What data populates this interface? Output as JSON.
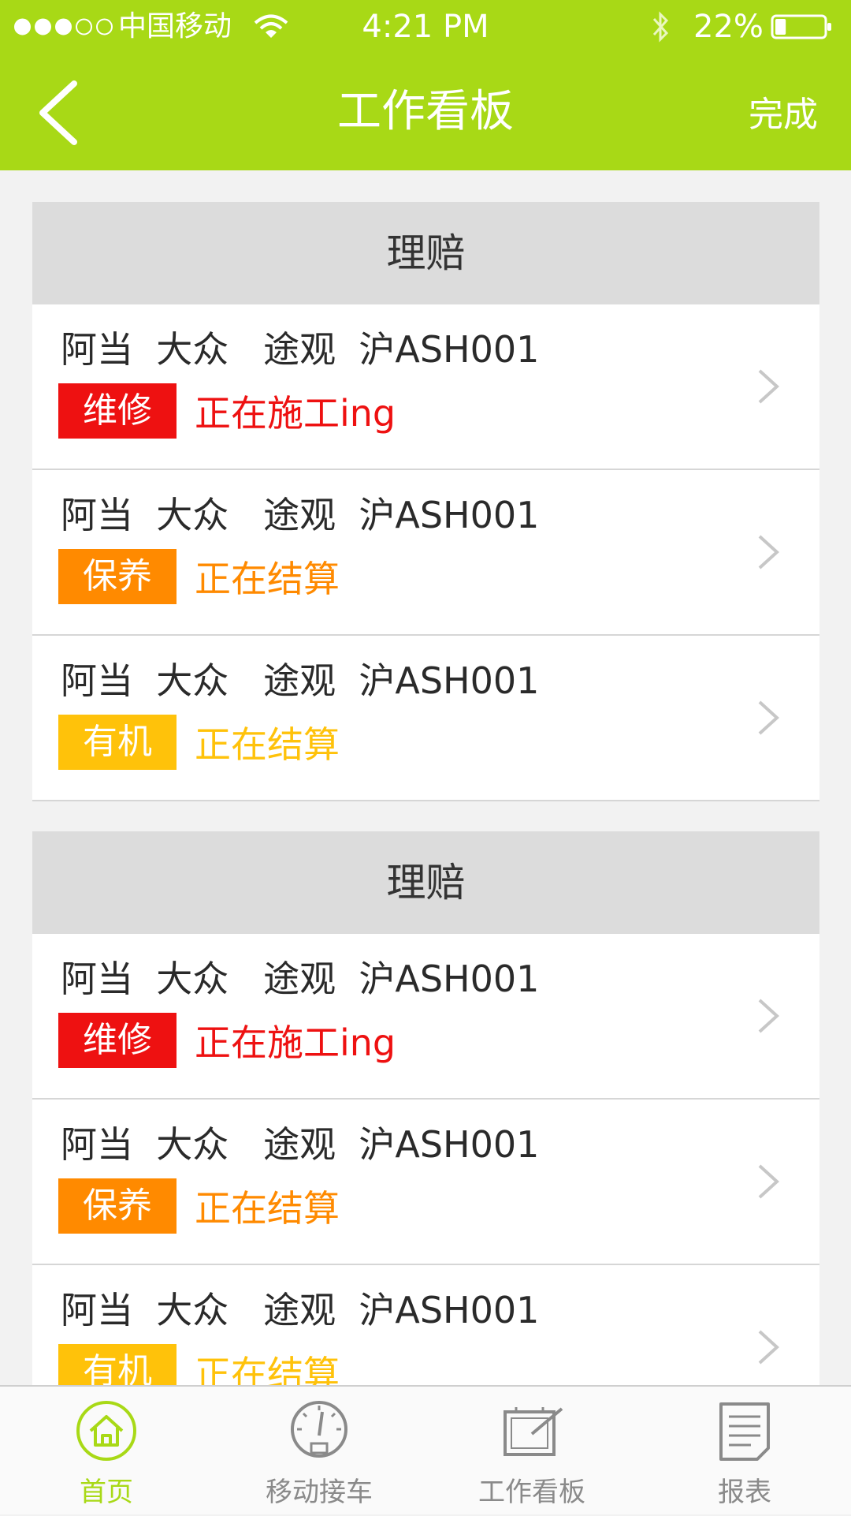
{
  "status_bar": {
    "carrier": "中国移动",
    "time": "4:21 PM",
    "battery": "22%",
    "battery_level": 0.22
  },
  "nav": {
    "title": "工作看板",
    "done": "完成"
  },
  "colors": {
    "brand": "#a8d916",
    "tag_repair": "#ee1111",
    "tag_maintenance": "#ff8a00",
    "tag_organic": "#ffc20a"
  },
  "sections": [
    {
      "title": "理赔",
      "rows": [
        {
          "title": "阿当  大众   途观  沪ASH001",
          "tag": "维修",
          "status": "正在施工ing"
        },
        {
          "title": "阿当  大众   途观  沪ASH001",
          "tag": "保养",
          "status": "正在结算"
        },
        {
          "title": "阿当  大众   途观  沪ASH001",
          "tag": "有机",
          "status": "正在结算"
        }
      ]
    },
    {
      "title": "理赔",
      "rows": [
        {
          "title": "阿当  大众   途观  沪ASH001",
          "tag": "维修",
          "status": "正在施工ing"
        },
        {
          "title": "阿当  大众   途观  沪ASH001",
          "tag": "保养",
          "status": "正在结算"
        },
        {
          "title": "阿当  大众   途观  沪ASH001",
          "tag": "有机",
          "status": "正在结算"
        }
      ]
    }
  ],
  "tabs": [
    {
      "label": "首页",
      "icon": "home-icon",
      "active": true
    },
    {
      "label": "移动接车",
      "icon": "gauge-icon",
      "active": false
    },
    {
      "label": "工作看板",
      "icon": "board-icon",
      "active": false
    },
    {
      "label": "报表",
      "icon": "report-icon",
      "active": false
    }
  ]
}
